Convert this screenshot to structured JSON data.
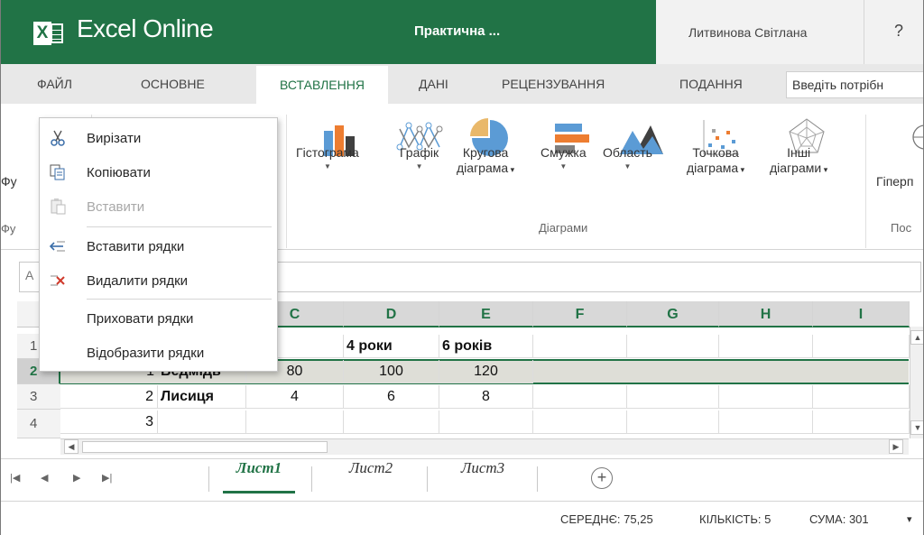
{
  "titlebar": {
    "logo_letter": "X",
    "app_name": "Excel Online",
    "doc_title": "Практична ...",
    "user_name": "Литвинова Світлана",
    "help": "?",
    "brand_color": "#217346"
  },
  "tabs": [
    {
      "label": "ФАЙЛ"
    },
    {
      "label": "ОСНОВНЕ"
    },
    {
      "label": "ВСТАВЛЕННЯ",
      "active": true
    },
    {
      "label": "ДАНІ"
    },
    {
      "label": "РЕЦЕНЗУВАННЯ"
    },
    {
      "label": "ПОДАННЯ"
    }
  ],
  "tell_me": "Введіть потрібн",
  "ribbon": {
    "left_clip_1": "Фу",
    "left_clip_2": "Фу",
    "charts": {
      "column": "Гістограма",
      "line": "Графік",
      "pie_1": "Кругова",
      "pie_2": "діаграма",
      "bar": "Смужка",
      "area": "Область",
      "scatter_1": "Точкова",
      "scatter_2": "діаграма",
      "other_1": "Інші",
      "other_2": "діаграми",
      "group_label": "Діаграми"
    },
    "hyperlink_clip": "Гіперп",
    "links_group_clip": "Пос"
  },
  "context_menu": [
    {
      "label": "Вирізати",
      "icon": "scissors-icon"
    },
    {
      "label": "Копіювати",
      "icon": "copy-icon"
    },
    {
      "label": "Вставити",
      "icon": "paste-icon",
      "disabled": true
    },
    {
      "label": "Вставити рядки",
      "icon": "insert-rows-icon"
    },
    {
      "label": "Видалити рядки",
      "icon": "delete-rows-icon"
    },
    {
      "label": "Приховати рядки"
    },
    {
      "label": "Відобразити рядки"
    }
  ],
  "formula_bar": {
    "namebox_clip": "А"
  },
  "grid": {
    "columns": [
      "C",
      "D",
      "E",
      "F",
      "G",
      "H",
      "I"
    ],
    "rows": [
      "1",
      "2",
      "3",
      "4"
    ],
    "selected_row": "2",
    "cells": {
      "r1_b": "оки",
      "r1_c": "4 роки",
      "r1_d": "6 років",
      "r2_a": "1",
      "r2_b": "Ведмідь",
      "r2_c": "80",
      "r2_d": "100",
      "r2_e": "120",
      "r3_a": "2",
      "r3_b": "Лисиця",
      "r3_c": "4",
      "r3_d": "6",
      "r3_e": "8",
      "r4_a": "3"
    }
  },
  "sheets": [
    {
      "label": "Лист1",
      "active": true
    },
    {
      "label": "Лист2"
    },
    {
      "label": "Лист3"
    }
  ],
  "status": {
    "average": "СЕРЕДНЄ: 75,25",
    "count": "КІЛЬКІСТЬ: 5",
    "sum": "СУМА: 301",
    "dropdown": "▾"
  }
}
